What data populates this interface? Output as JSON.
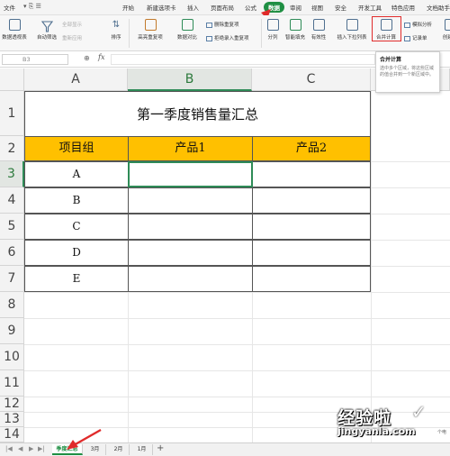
{
  "menu": {
    "items": [
      "文件",
      "开始",
      "新建选项卡",
      "插入",
      "页面布局",
      "公式",
      "数据",
      "审阅",
      "视图",
      "安全",
      "开发工具",
      "特色应用",
      "文档助手"
    ],
    "active": "数据"
  },
  "ribbon": {
    "pivot": "数据透视表",
    "autofilter": "自动筛选",
    "show_all": "全部显示",
    "reapply": "重新应用",
    "sort": "排序",
    "highlight_dup": "高亮重复项",
    "data_compare": "数据对比",
    "remove_dup": "删除重复项",
    "reject_dup": "拒绝录入重复项",
    "text_to_col": "分列",
    "flash_fill": "智能填充",
    "validity": "有效性",
    "dropdown": "插入下拉列表",
    "consolidate": "合并计算",
    "simulate": "模拟分析",
    "record": "记录单",
    "create_group": "创建组"
  },
  "tooltip": {
    "title": "合并计算",
    "body": "选中多个区域，将这些区域的值合并到一个新区域中。"
  },
  "formula_bar": {
    "name_box": "B3",
    "fx": "fx",
    "formula": ""
  },
  "grid": {
    "columns": [
      "A",
      "B",
      "C"
    ],
    "rows": [
      "1",
      "2",
      "3",
      "4",
      "5",
      "6",
      "7",
      "8",
      "9",
      "10",
      "11",
      "12",
      "13",
      "14"
    ],
    "selected_column": "B",
    "selected_row": "3"
  },
  "sheet": {
    "title": "第一季度销售量汇总",
    "headers": [
      "项目组",
      "产品1",
      "产品2"
    ],
    "rows": [
      {
        "group": "A",
        "p1": "",
        "p2": ""
      },
      {
        "group": "B",
        "p1": "",
        "p2": ""
      },
      {
        "group": "C",
        "p1": "",
        "p2": ""
      },
      {
        "group": "D",
        "p1": "",
        "p2": ""
      },
      {
        "group": "E",
        "p1": "",
        "p2": ""
      }
    ]
  },
  "tabs": {
    "items": [
      "季度汇总",
      "3月",
      "2月",
      "1月"
    ],
    "active": "季度汇总",
    "add": "+"
  },
  "watermark": {
    "line1": "经验啦",
    "line2": "jingyanla.com",
    "edge": "个电"
  },
  "colors": {
    "accent": "#1f8f43",
    "header_fill": "#ffc000",
    "highlight": "#e02b2b"
  }
}
